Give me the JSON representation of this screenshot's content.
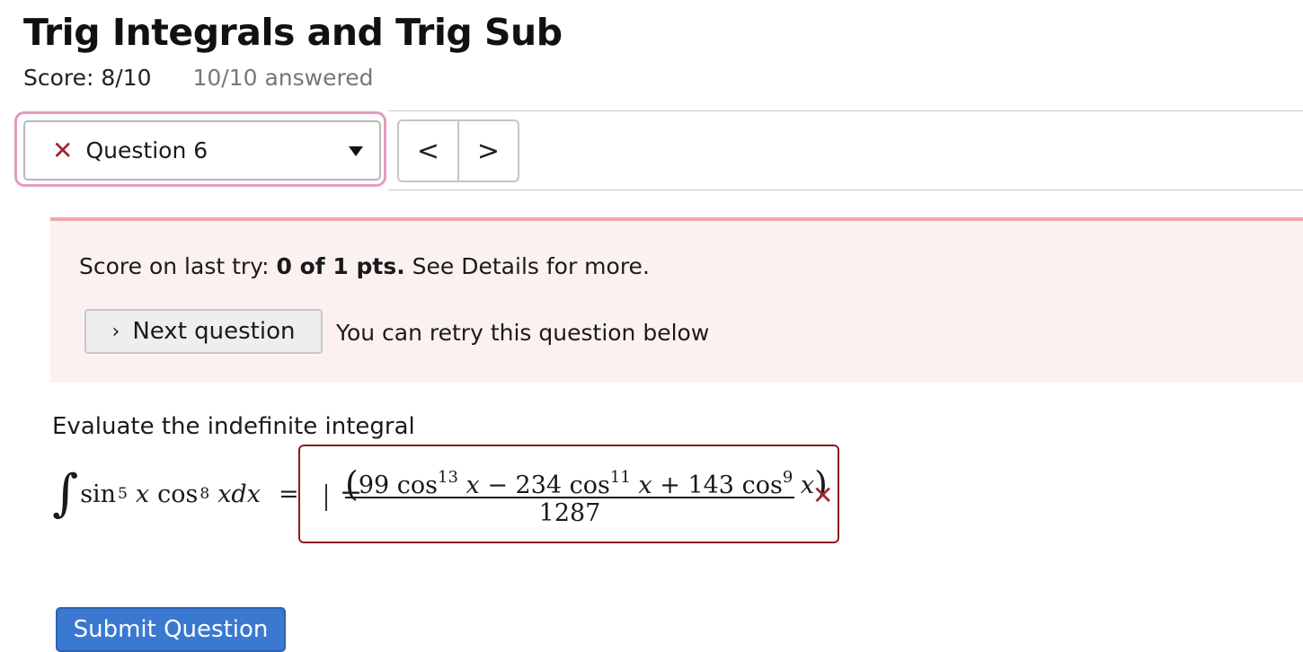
{
  "header": {
    "title": "Trig Integrals and Trig Sub",
    "score": "Score: 8/10",
    "answered": "10/10 answered"
  },
  "question_nav": {
    "selected": "Question 6",
    "status_icon": "x-icon",
    "prev_symbol": "<",
    "next_symbol": ">"
  },
  "alert": {
    "prefix": "Score on last try: ",
    "score_bold": "0 of 1 pts.",
    "suffix": " See Details for more.",
    "next_button": "Next question",
    "retry_text": "You can retry this question below"
  },
  "question": {
    "prompt": "Evaluate the indefinite integral",
    "lhs": {
      "sin": "sin",
      "sin_exp": "5",
      "var": "x",
      "cos": "cos",
      "cos_exp": "8",
      "dx": "xdx",
      "equals": "="
    },
    "answer": {
      "sign": "−",
      "term1_coef": "99 cos",
      "term1_exp": "13",
      "op1": "−",
      "term2_coef": "234 cos",
      "term2_exp": "11",
      "op2": "+",
      "term3_coef": "143 cos",
      "term3_exp": "9",
      "var": "x",
      "denominator": "1287",
      "status": "incorrect"
    }
  },
  "submit_label": "Submit Question",
  "colors": {
    "error": "#a12727",
    "alert_bg": "#fcf1f1",
    "submit_bg": "#3b78d0",
    "focus_ring": "#e39cc1"
  }
}
